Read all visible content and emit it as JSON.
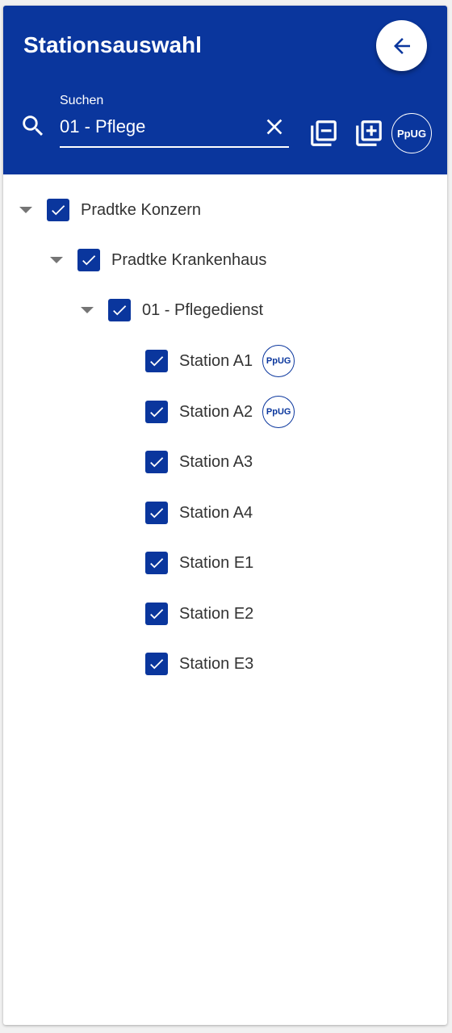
{
  "header": {
    "title": "Stationsauswahl",
    "search_label": "Suchen",
    "search_value": "01 - Pflege",
    "ppug_label": "PpUG"
  },
  "colors": {
    "brand": "#0a369d",
    "text": "#333333",
    "caret": "#757575"
  },
  "tree": {
    "root": {
      "label": "Pradtke Konzern"
    },
    "hospital": {
      "label": "Pradtke Krankenhaus"
    },
    "department": {
      "label": "01 - Pflegedienst"
    },
    "stations": [
      {
        "label": "Station A1",
        "ppug": "PpUG"
      },
      {
        "label": "Station A2",
        "ppug": "PpUG"
      },
      {
        "label": "Station A3"
      },
      {
        "label": "Station A4"
      },
      {
        "label": "Station E1"
      },
      {
        "label": "Station E2"
      },
      {
        "label": "Station E3"
      }
    ]
  }
}
